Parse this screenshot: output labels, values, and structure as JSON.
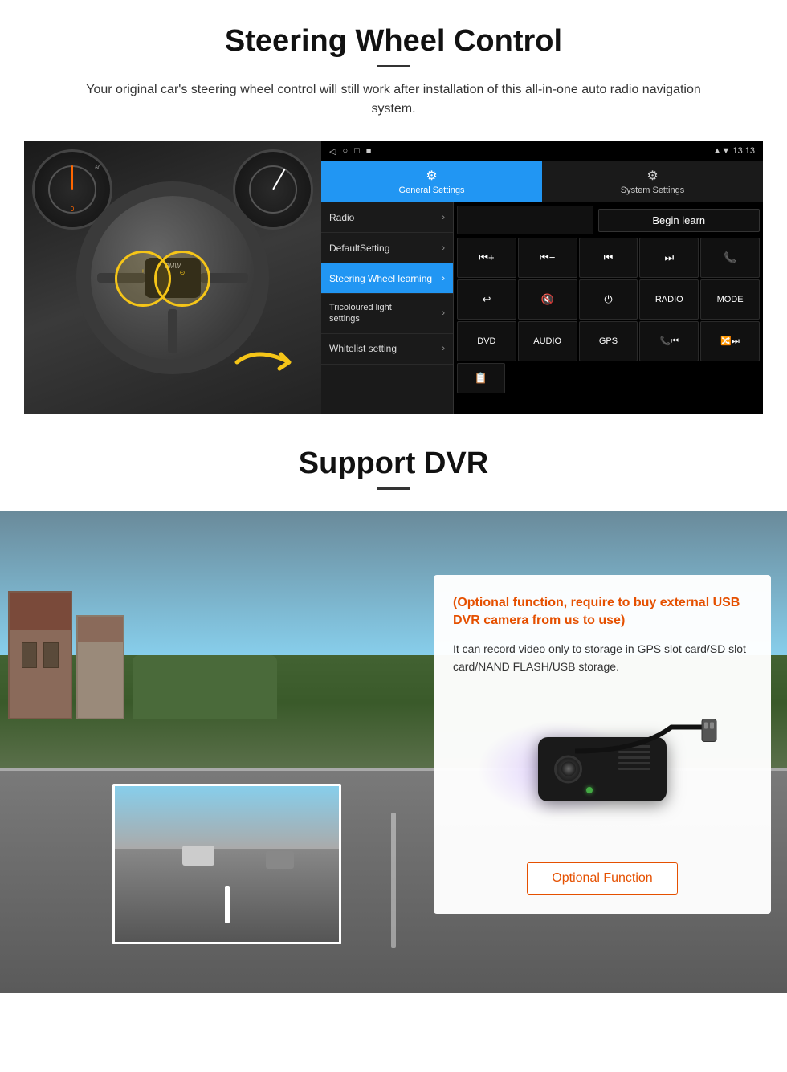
{
  "section1": {
    "title": "Steering Wheel Control",
    "description": "Your original car's steering wheel control will still work after installation of this all-in-one auto radio navigation system.",
    "status_bar": {
      "time": "13:13",
      "icons": [
        "◁",
        "○",
        "□",
        "■"
      ]
    },
    "tabs": {
      "general": {
        "label": "General Settings",
        "icon": "⚙"
      },
      "system": {
        "label": "System Settings",
        "icon": "🔗"
      }
    },
    "menu_items": [
      {
        "label": "Radio",
        "active": false
      },
      {
        "label": "DefaultSetting",
        "active": false
      },
      {
        "label": "Steering Wheel learning",
        "active": true
      },
      {
        "label": "Tricoloured light settings",
        "active": false
      },
      {
        "label": "Whitelist setting",
        "active": false
      }
    ],
    "begin_learn_label": "Begin learn",
    "control_buttons": [
      [
        "⏮+",
        "⏮−",
        "⏮",
        "⏭",
        "📞"
      ],
      [
        "↩",
        "🔇",
        "⏻",
        "RADIO",
        "MODE"
      ],
      [
        "DVD",
        "AUDIO",
        "GPS",
        "📞⏮",
        "🔀⏭"
      ]
    ],
    "extra_btn": "📋"
  },
  "section2": {
    "title": "Support DVR",
    "card": {
      "title": "(Optional function, require to buy external USB DVR camera from us to use)",
      "description": "It can record video only to storage in GPS slot card/SD slot card/NAND FLASH/USB storage."
    },
    "optional_btn_label": "Optional Function"
  }
}
